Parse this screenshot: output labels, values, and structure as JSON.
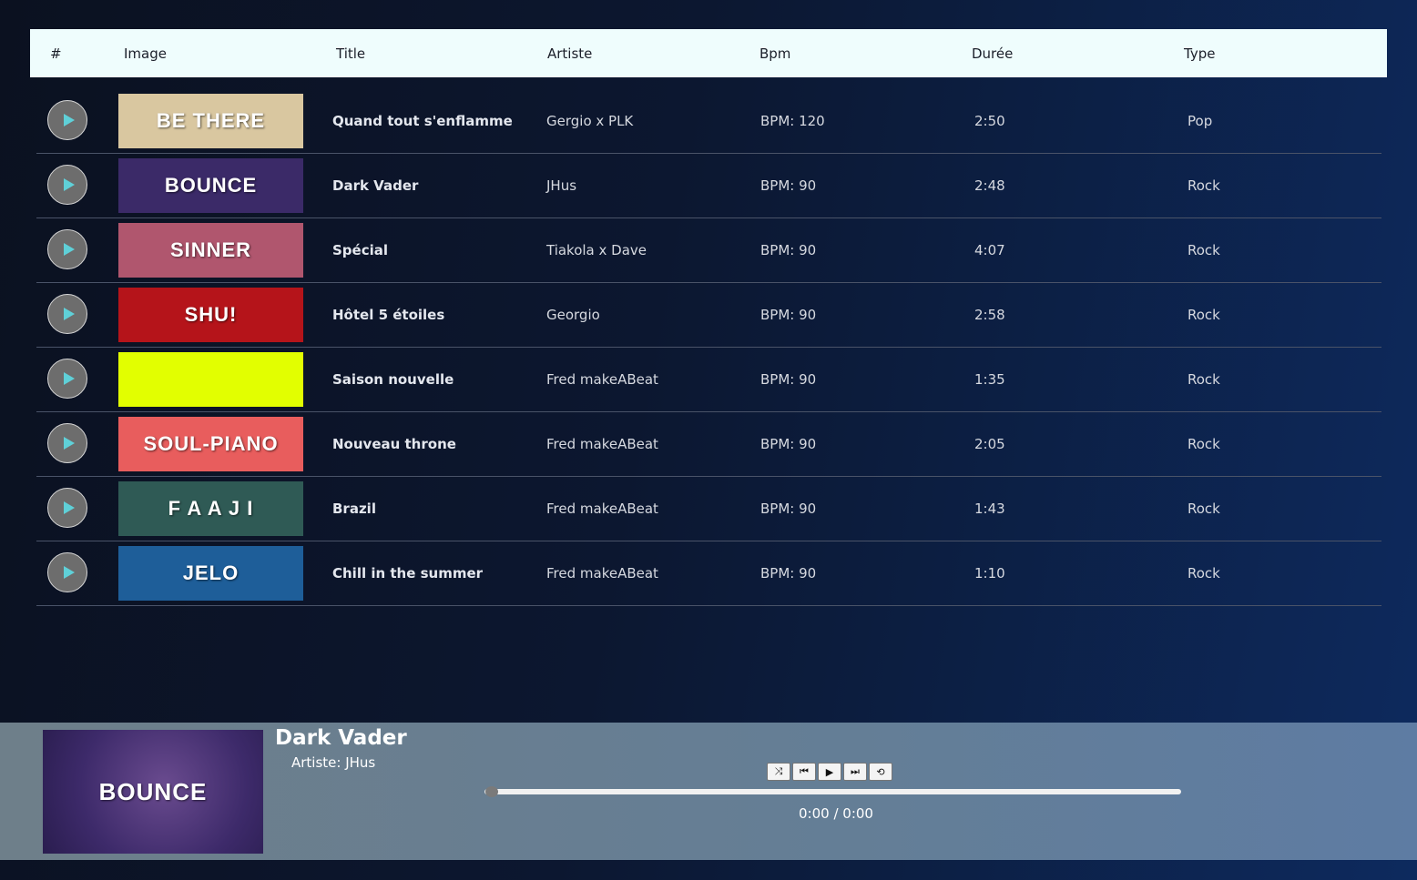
{
  "table": {
    "headers": [
      "#",
      "Image",
      "Title",
      "Artiste",
      "Bpm",
      "Durée",
      "Type"
    ],
    "tracks": [
      {
        "cover_text": "BE THERE",
        "cover_bg": "#d9c7a0",
        "title": "Quand tout s'enflamme",
        "artist": "Gergio x PLK",
        "bpm": "BPM: 120",
        "duration": "2:50",
        "type": "Pop"
      },
      {
        "cover_text": "BOUNCE",
        "cover_bg": "#3b2a68",
        "title": "Dark Vader",
        "artist": "JHus",
        "bpm": "BPM: 90",
        "duration": "2:48",
        "type": "Rock"
      },
      {
        "cover_text": "SINNER",
        "cover_bg": "#b0566e",
        "title": "Spécial",
        "artist": "Tiakola x Dave",
        "bpm": "BPM: 90",
        "duration": "4:07",
        "type": "Rock"
      },
      {
        "cover_text": "SHU!",
        "cover_bg": "#b5141a",
        "title": "Hôtel 5 étoiles",
        "artist": "Georgio",
        "bpm": "BPM: 90",
        "duration": "2:58",
        "type": "Rock"
      },
      {
        "cover_text": "",
        "cover_bg": "#e2ff00",
        "title": "Saison nouvelle",
        "artist": "Fred makeABeat",
        "bpm": "BPM: 90",
        "duration": "1:35",
        "type": "Rock"
      },
      {
        "cover_text": "SOUL-PIANO",
        "cover_bg": "#e85d5d",
        "title": "Nouveau throne",
        "artist": "Fred makeABeat",
        "bpm": "BPM: 90",
        "duration": "2:05",
        "type": "Rock"
      },
      {
        "cover_text": "F A A J I",
        "cover_bg": "#2f5a55",
        "title": "Brazil",
        "artist": "Fred makeABeat",
        "bpm": "BPM: 90",
        "duration": "1:43",
        "type": "Rock"
      },
      {
        "cover_text": "JELO",
        "cover_bg": "#1e5e99",
        "title": "Chill in the summer",
        "artist": "Fred makeABeat",
        "bpm": "BPM: 90",
        "duration": "1:10",
        "type": "Rock"
      }
    ]
  },
  "player": {
    "cover_text": "BOUNCE",
    "title": "Dark Vader",
    "artist": "Artiste: JHus",
    "time": "0:00 / 0:00",
    "progress": 0,
    "controls": [
      {
        "name": "shuffle-button",
        "icon": "shuffle-icon",
        "glyph": "⤨"
      },
      {
        "name": "previous-button",
        "icon": "skip-previous-icon",
        "glyph": "⏮"
      },
      {
        "name": "play-button",
        "icon": "play-icon",
        "glyph": "▶"
      },
      {
        "name": "next-button",
        "icon": "skip-next-icon",
        "glyph": "⏭"
      },
      {
        "name": "repeat-button",
        "icon": "repeat-icon",
        "glyph": "⟲"
      }
    ]
  },
  "colors": {
    "header_bg": "#effdfd",
    "play_icon": "#5fd0d8",
    "row_divider": "#4a5368"
  }
}
